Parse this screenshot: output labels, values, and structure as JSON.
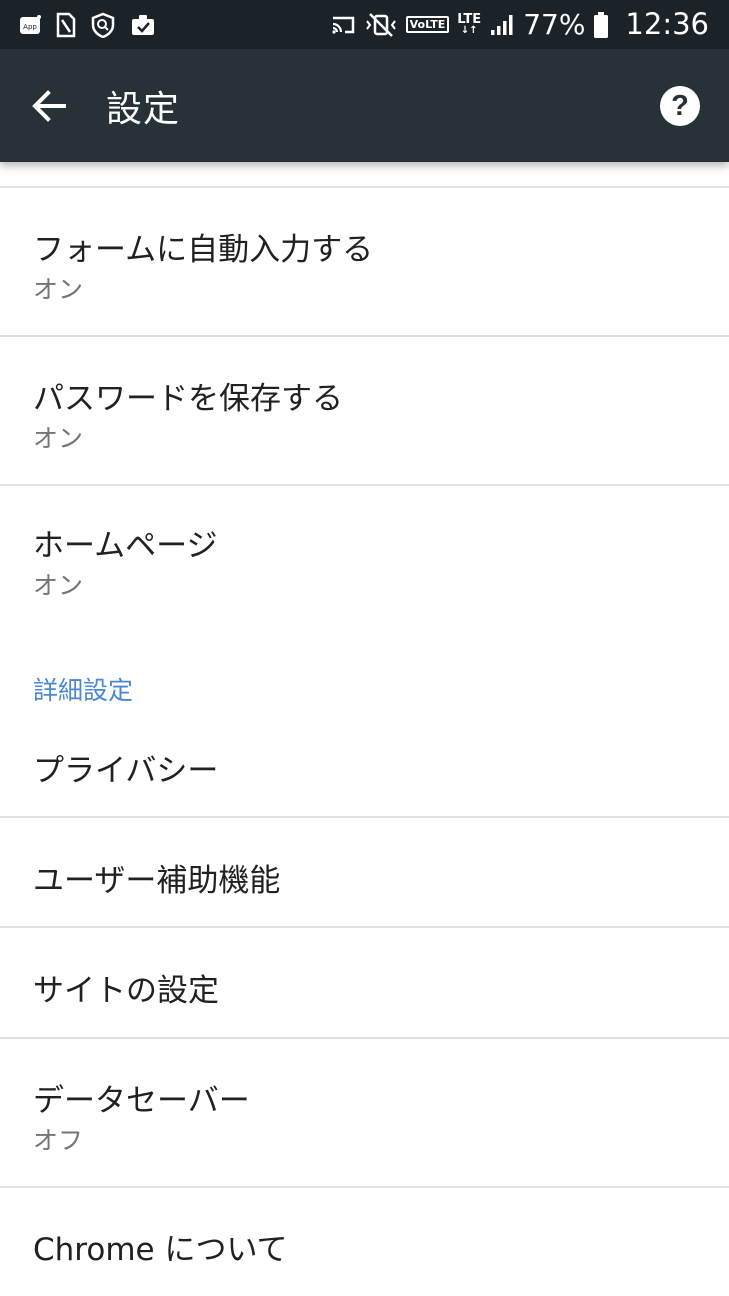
{
  "status_bar": {
    "battery": "77%",
    "time": "12:36",
    "volte": "VoLTE",
    "lte": "LTE",
    "icons": [
      "app-notification-icon",
      "sim-card-icon",
      "shield-search-icon",
      "clipboard-check-icon",
      "cast-icon",
      "vibrate-icon",
      "volte-icon",
      "lte-icon",
      "signal-icon",
      "battery-icon"
    ]
  },
  "app_bar": {
    "title": "設定",
    "help_label": "?",
    "color": "#263238"
  },
  "settings": {
    "autofill": {
      "title": "フォームに自動入力する",
      "summary": "オン"
    },
    "passwords": {
      "title": "パスワードを保存する",
      "summary": "オン"
    },
    "homepage": {
      "title": "ホームページ",
      "summary": "オン"
    },
    "advanced_header": "詳細設定",
    "privacy": {
      "title": "プライバシー"
    },
    "accessibility": {
      "title": "ユーザー補助機能"
    },
    "site_settings": {
      "title": "サイトの設定"
    },
    "data_saver": {
      "title": "データセーバー",
      "summary": "オフ"
    },
    "about_chrome": {
      "title": "Chrome について"
    }
  },
  "colors": {
    "accent": "#4a88d3",
    "status_bar": "#1b2328"
  }
}
